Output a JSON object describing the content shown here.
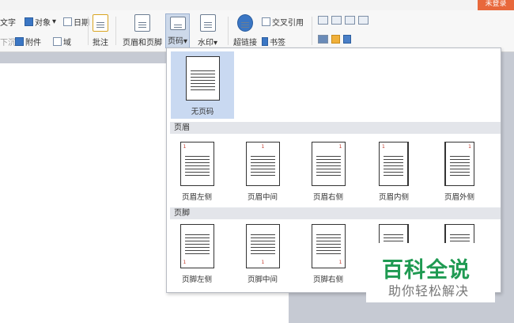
{
  "login_label": "未登录",
  "ribbon": {
    "row1": {
      "text_frag": "文字",
      "object": "对象",
      "date": "日期",
      "dropdown_caret": "▾"
    },
    "row2": {
      "sink_frag": "下沉",
      "attachment": "附件",
      "field": "域"
    },
    "comment": "批注",
    "header_footer": "页眉和页脚",
    "page_number": "页码",
    "watermark": "水印",
    "hyperlink": "超链接",
    "cross_ref": "交叉引用",
    "bookmark": "书签"
  },
  "dropdown": {
    "none_option": "无页码",
    "header_section": "页眉",
    "header_options": [
      "页眉左侧",
      "页眉中间",
      "页眉右侧",
      "页眉内侧",
      "页眉外侧"
    ],
    "footer_section": "页脚",
    "footer_options": [
      "页脚左侧",
      "页脚中间",
      "页脚右侧"
    ],
    "page_num_glyph": "1"
  },
  "watermark_logo": {
    "title": "百科全说",
    "subtitle": "助你轻松解决"
  },
  "colors": {
    "accent_orange": "#e8683b",
    "selection_blue": "#c9d9f1",
    "logo_green": "#1f9a52",
    "page_number_red": "#c0392b"
  }
}
